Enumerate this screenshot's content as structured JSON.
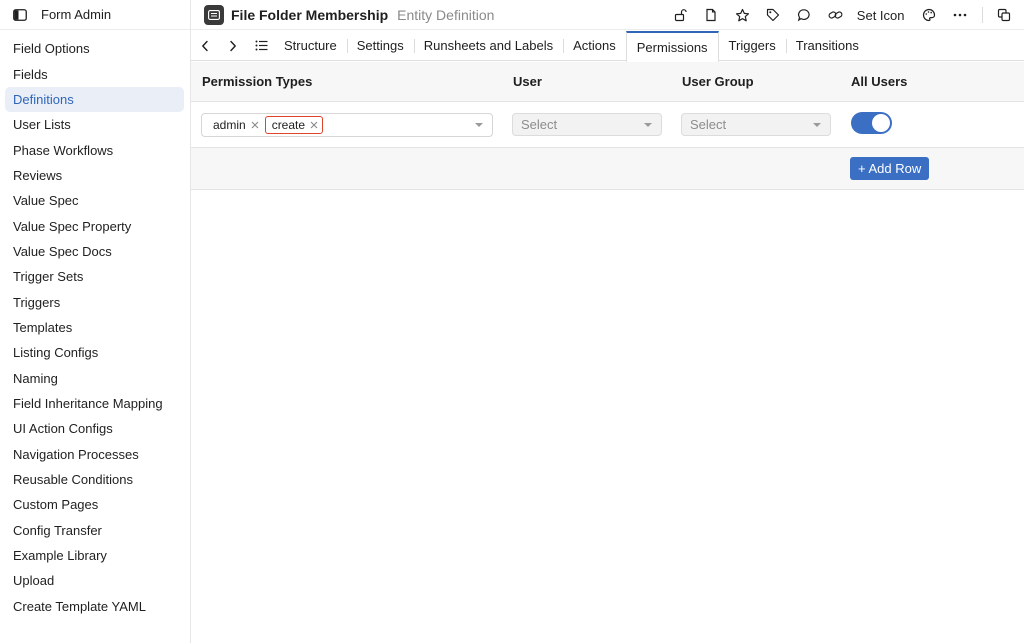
{
  "app": {
    "title": "Form Admin"
  },
  "sidebar": {
    "items": [
      {
        "label": "Field Options"
      },
      {
        "label": "Fields"
      },
      {
        "label": "Definitions",
        "active": true
      },
      {
        "label": "User Lists"
      },
      {
        "label": "Phase Workflows"
      },
      {
        "label": "Reviews"
      },
      {
        "label": "Value Spec"
      },
      {
        "label": "Value Spec Property"
      },
      {
        "label": "Value Spec Docs"
      },
      {
        "label": "Trigger Sets"
      },
      {
        "label": "Triggers"
      },
      {
        "label": "Templates"
      },
      {
        "label": "Listing Configs"
      },
      {
        "label": "Naming"
      },
      {
        "label": "Field Inheritance Mapping"
      },
      {
        "label": "UI Action Configs"
      },
      {
        "label": "Navigation Processes"
      },
      {
        "label": "Reusable Conditions"
      },
      {
        "label": "Custom Pages"
      },
      {
        "label": "Config Transfer"
      },
      {
        "label": "Example Library"
      },
      {
        "label": "Upload"
      },
      {
        "label": "Create Template YAML"
      }
    ]
  },
  "header": {
    "title": "File Folder Membership",
    "subtitle": "Entity Definition",
    "set_icon_label": "Set Icon"
  },
  "tabs": [
    {
      "label": "Structure"
    },
    {
      "label": "Settings"
    },
    {
      "label": "Runsheets and Labels"
    },
    {
      "label": "Actions"
    },
    {
      "label": "Permissions",
      "active": true
    },
    {
      "label": "Triggers"
    },
    {
      "label": "Transitions"
    }
  ],
  "table": {
    "columns": [
      "Permission Types",
      "User",
      "User Group",
      "All Users"
    ],
    "row": {
      "permission_chips": [
        "admin",
        "create"
      ],
      "user_placeholder": "Select",
      "user_group_placeholder": "Select",
      "all_users": true
    },
    "add_row_label": "+ Add Row"
  },
  "colors": {
    "accent": "#3a6fc4",
    "highlight": "#e0442c"
  }
}
